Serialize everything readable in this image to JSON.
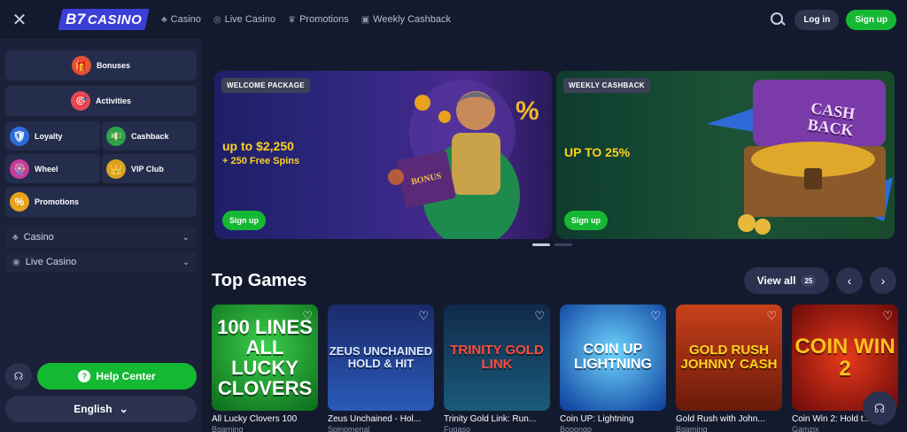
{
  "header": {
    "logo_num": "B7",
    "logo_text": "CASINO",
    "nav": [
      {
        "label": "Casino",
        "icon": "cherries-icon"
      },
      {
        "label": "Live Casino",
        "icon": "live-icon"
      },
      {
        "label": "Promotions",
        "icon": "crown-icon"
      },
      {
        "label": "Weekly Cashback",
        "icon": "gift-icon"
      }
    ],
    "login_label": "Log in",
    "signup_label": "Sign up"
  },
  "sidebar": {
    "bonuses": "Bonuses",
    "activities": "Activities",
    "loyalty": "Loyalty",
    "cashback": "Cashback",
    "wheel": "Wheel",
    "vip_club": "VIP Club",
    "promotions": "Promotions",
    "casino": "Casino",
    "live_casino": "Live Casino",
    "help_center": "Help Center",
    "language": "English"
  },
  "banners": [
    {
      "badge": "WELCOME PACKAGE",
      "title": "up to $2,250",
      "subtitle": "+ 250 Free Spins",
      "button": "Sign up"
    },
    {
      "badge": "WEEKLY CASHBACK",
      "title": "UP TO 25%",
      "button": "Sign up",
      "art_text": "CASH BACK"
    }
  ],
  "carousel": {
    "active_index": 0,
    "count": 2
  },
  "top_games": {
    "title": "Top Games",
    "view_all_label": "View all",
    "count": "25",
    "games": [
      {
        "name": "All Lucky Clovers 100",
        "provider": "Bgaming",
        "art": "100 LINES ALL LUCKY CLOVERS"
      },
      {
        "name": "Zeus Unchained - Hol...",
        "provider": "Spinomenal",
        "art": "ZEUS UNCHAINED HOLD & HIT"
      },
      {
        "name": "Trinity Gold Link: Run...",
        "provider": "Fugaso",
        "art": "TRINITY GOLD LINK"
      },
      {
        "name": "Coin UP: Lightning",
        "provider": "Booongo",
        "art": "COIN UP LIGHTNING"
      },
      {
        "name": "Gold Rush with John...",
        "provider": "Bgaming",
        "art": "GOLD RUSH JOHNNY CASH"
      },
      {
        "name": "Coin Win 2: Hold t...",
        "provider": "Gamzix",
        "art": "COIN WIN 2"
      }
    ]
  },
  "colors": {
    "accent_green": "#15b833",
    "bg": "#141a2e",
    "promo_yellow": "#ffd21f"
  }
}
